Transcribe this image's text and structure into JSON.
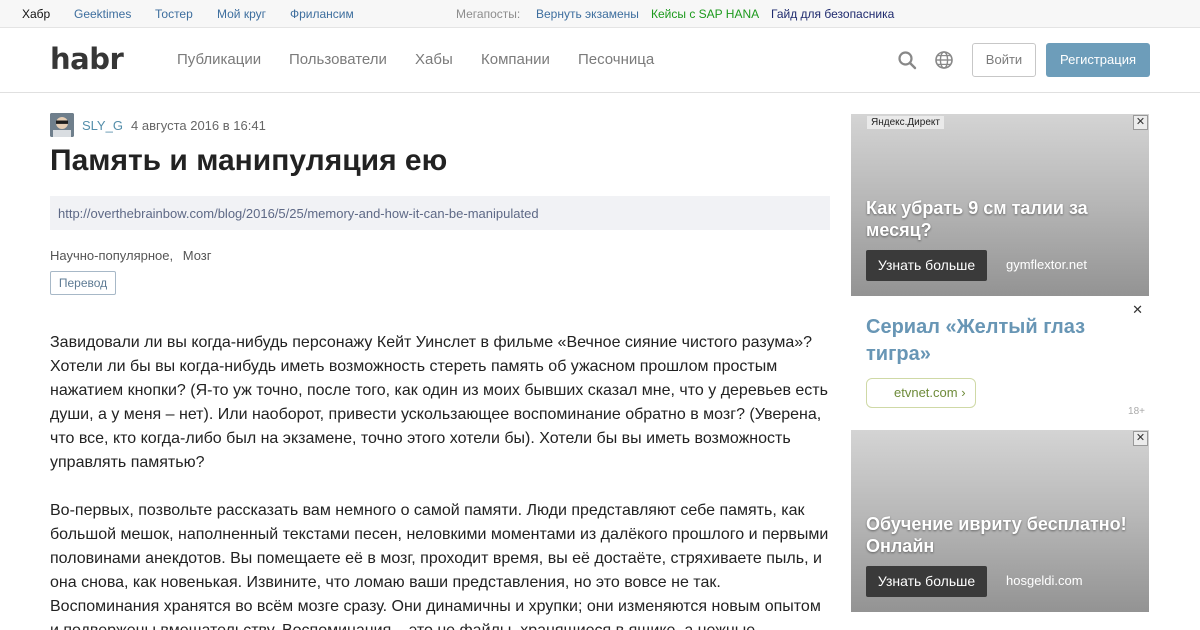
{
  "topbar": {
    "brand": "Хабр",
    "sites": [
      "Geektimes",
      "Тостер",
      "Мой круг",
      "Фрилансим"
    ],
    "megaposts_label": "Мегапосты:",
    "megaposts": [
      "Вернуть экзамены",
      "Кейсы с SAP HANA",
      "Гайд для безопасника"
    ],
    "colors": {
      "link": "#3d6e9e",
      "green": "#1c9a1c",
      "navy": "#1e2a6e"
    }
  },
  "header": {
    "logo": "habr",
    "nav": [
      "Публикации",
      "Пользователи",
      "Хабы",
      "Компании",
      "Песочница"
    ],
    "search_icon": "search-icon",
    "language_icon": "globe-icon",
    "login_label": "Войти",
    "register_label": "Регистрация",
    "accent": "#6d9dba"
  },
  "article": {
    "author": "SLY_G",
    "date": "4 августа 2016 в 16:41",
    "title": "Память и манипуляция ею",
    "source_url": "http://overthebrainbow.com/blog/2016/5/25/memory-and-how-it-can-be-manipulated",
    "hubs": [
      "Научно-популярное,",
      "Мозг"
    ],
    "type_badge": "Перевод",
    "paragraph1": "Завидовали ли вы когда-нибудь персонажу Кейт Уинслет в фильме «Вечное сияние чистого разума»? Хотели ли бы вы когда-нибудь иметь возможность стереть память об ужасном прошлом простым нажатием кнопки? (Я-то уж точно, после того, как один из моих бывших сказал мне, что у деревьев есть души, а у меня – нет). Или наоборот, привести ускользающее воспоминание обратно в мозг? (Уверена, что все, кто когда-либо был на экзамене, точно этого хотели бы). Хотели бы вы иметь возможность управлять памятью?",
    "paragraph2": "Во-первых, позвольте рассказать вам немного о самой памяти. Люди представляют себе память, как большой мешок, наполненный текстами песен, неловкими моментами из далёкого прошлого и первыми половинами анекдотов. Вы помещаете её в мозг, проходит время, вы её достаёте, стряхиваете пыль, и она снова, как новенькая. Извините, что ломаю ваши представления, но это вовсе не так. Воспоминания хранятся во всём мозге сразу. Они динамичны и хрупки; они изменяются новым опытом и подвержены вмешательству. Воспоминания – это не файлы, хранящиеся в ящике, а нежные"
  },
  "ads": {
    "ad1": {
      "source": "Яндекс.Директ",
      "close": "✕",
      "headline": "Как убрать 9 см талии за месяц?",
      "cta": "Узнать больше",
      "domain": "gymflextor.net"
    },
    "ad2": {
      "close": "✕",
      "headline": "Сериал «Желтый глаз тигра»",
      "domain": "etvnet.com ›",
      "age": "18+"
    },
    "ad3": {
      "close": "✕",
      "headline": "Обучение ивриту бесплатно! Онлайн",
      "cta": "Узнать больше",
      "domain": "hosgeldi.com"
    }
  }
}
